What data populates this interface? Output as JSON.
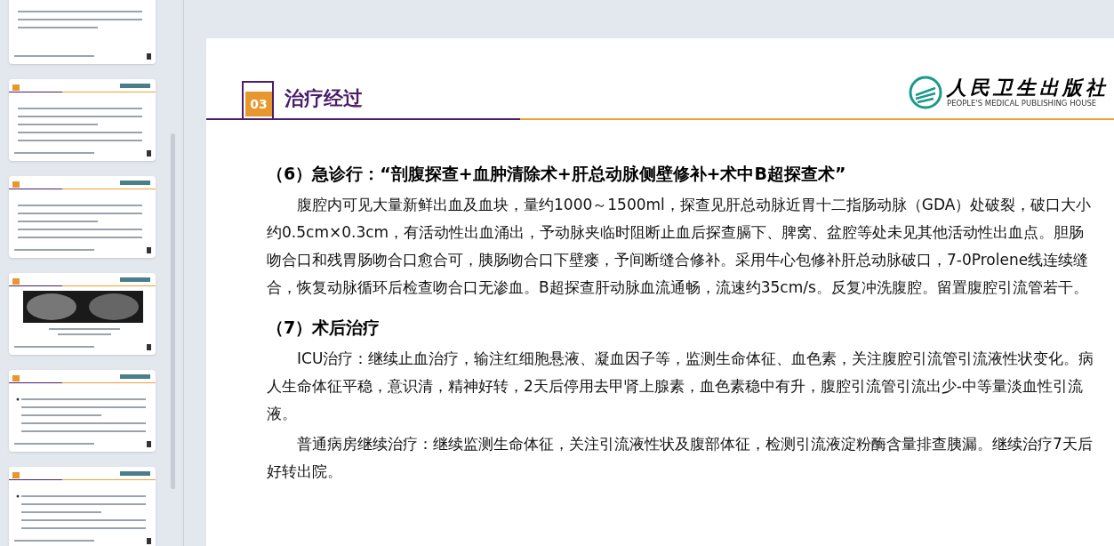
{
  "sidebar": {
    "thumbnails": [
      {
        "kind": "text"
      },
      {
        "kind": "text"
      },
      {
        "kind": "text"
      },
      {
        "kind": "image"
      },
      {
        "kind": "list"
      },
      {
        "kind": "list"
      }
    ]
  },
  "slide": {
    "section_number": "03",
    "title": "治疗经过",
    "publisher": {
      "name": "人民卫生出版社",
      "name_en": "PEOPLE'S MEDICAL PUBLISHING HOUSE"
    },
    "sections": [
      {
        "heading": "（6）急诊行：“剖腹探查+血肿清除术+肝总动脉侧壁修补+术中B超探查术”",
        "paragraphs": [
          "腹腔内可见大量新鲜出血及血块，量约1000～1500ml，探查见肝总动脉近胃十二指肠动脉（GDA）处破裂，破口大小约0.5cm×0.3cm，有活动性出血涌出，予动脉夹临时阻断止血后探查膈下、脾窝、盆腔等处未见其他活动性出血点。胆肠吻合口和残胃肠吻合口愈合可，胰肠吻合口下壁瘘，予间断缝合修补。采用牛心包修补肝总动脉破口，7-0Prolene线连续缝合，恢复动脉循环后检查吻合口无渗血。B超探查肝动脉血流通畅，流速约35cm/s。反复冲洗腹腔。留置腹腔引流管若干。"
        ]
      },
      {
        "heading": "（7）术后治疗",
        "paragraphs": [
          "ICU治疗：继续止血治疗，输注红细胞悬液、凝血因子等，监测生命体征、血色素，关注腹腔引流管引流液性状变化。病人生命体征平稳，意识清，精神好转，2天后停用去甲肾上腺素，血色素稳中有升，腹腔引流管引流出少-中等量淡血性引流液。",
          "普通病房继续治疗：继续监测生命体征，关注引流液性状及腹部体征，检测引流液淀粉酶含量排查胰漏。继续治疗7天后好转出院。"
        ]
      }
    ]
  }
}
